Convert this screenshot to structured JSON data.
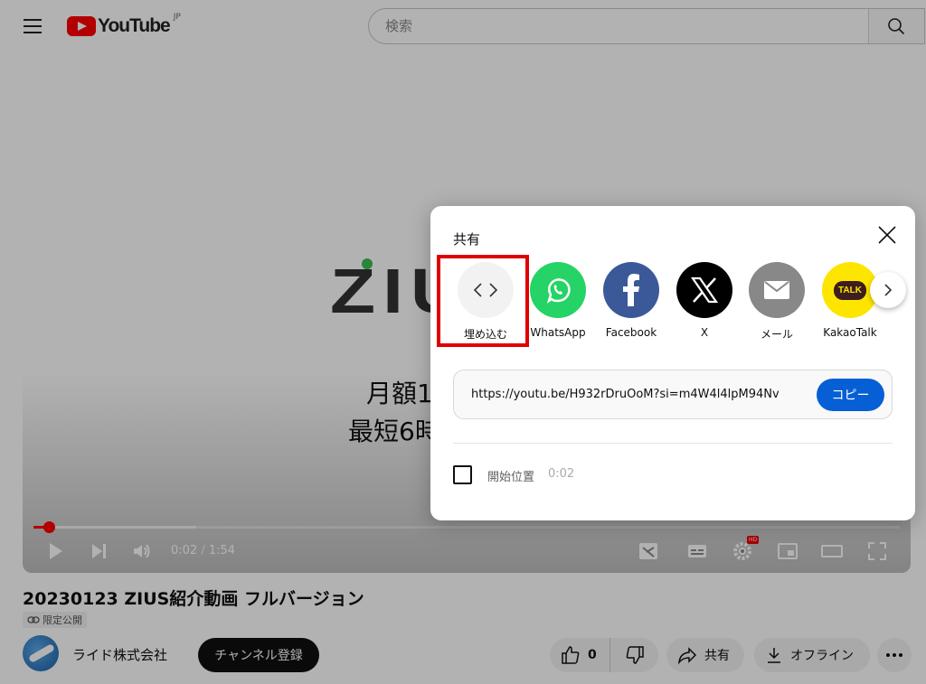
{
  "header": {
    "logo_text": "YouTube",
    "country_code": "JP",
    "search_placeholder": "検索"
  },
  "video": {
    "frame_logo": "ZIU",
    "frame_line1": "月額1",
    "frame_line2": "最短6時",
    "time_current": "0:02",
    "time_separator": "/",
    "time_total": "1:54",
    "progress_fraction": 0.0175,
    "settings_badge": "HD"
  },
  "info": {
    "title": "20230123 ZIUS紹介動画 フルバージョン",
    "privacy": "限定公開",
    "channel_name": "ライド株式会社",
    "subscribe_label": "チャンネル登録",
    "like_count": "0",
    "share_label": "共有",
    "offline_label": "オフライン"
  },
  "share_dialog": {
    "title": "共有",
    "targets": [
      {
        "label": "埋め込む",
        "icon": "embed-code-icon",
        "color": "#f2f2f2"
      },
      {
        "label": "WhatsApp",
        "icon": "whatsapp-icon",
        "color": "#25d366"
      },
      {
        "label": "Facebook",
        "icon": "facebook-icon",
        "color": "#3b5998"
      },
      {
        "label": "X",
        "icon": "x-icon",
        "color": "#000000"
      },
      {
        "label": "メール",
        "icon": "mail-icon",
        "color": "#888888"
      },
      {
        "label": "KakaoTalk",
        "icon": "kakaotalk-icon",
        "color": "#fee500"
      }
    ],
    "kakao_badge": "TALK",
    "url": "https://youtu.be/H932rDruOoM?si=m4W4l4lpM94Nv",
    "copy_label": "コピー",
    "start_at_label": "開始位置",
    "start_at_time": "0:02"
  },
  "colors": {
    "brand_red": "#ff0000",
    "highlight_red": "#e00000",
    "copy_blue": "#065fd4"
  }
}
